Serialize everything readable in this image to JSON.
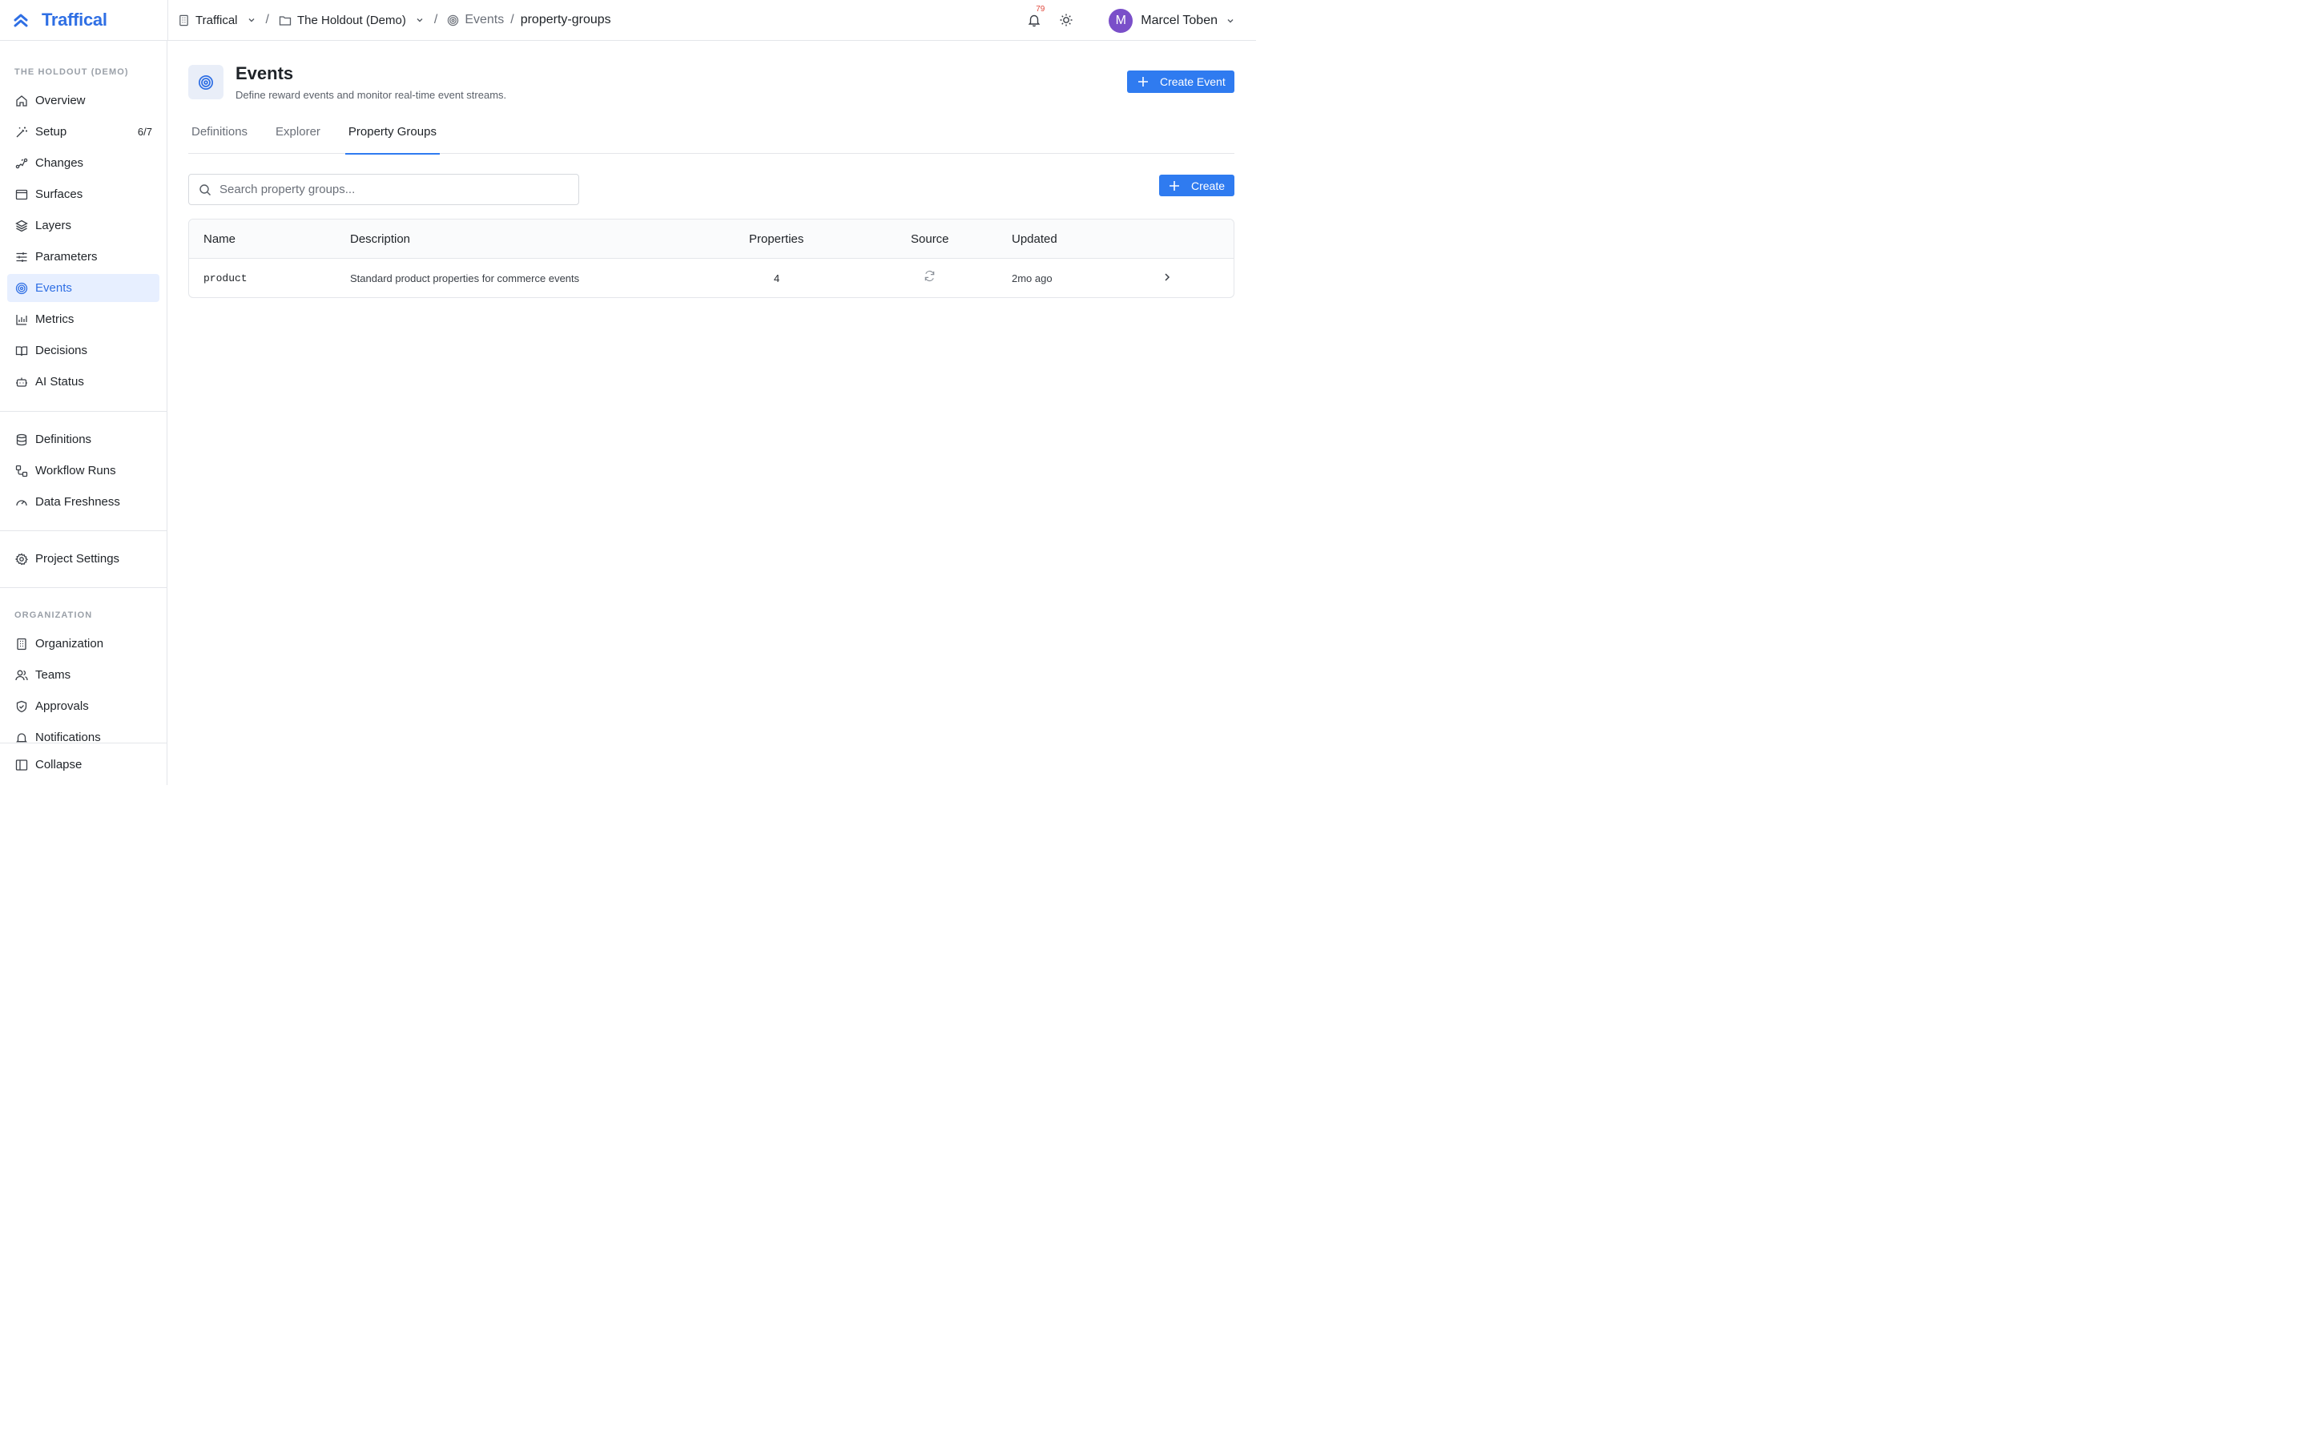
{
  "brand": {
    "name": "Traffical"
  },
  "breadcrumb": {
    "org": "Traffical",
    "project": "The Holdout (Demo)",
    "section": "Events",
    "current": "property-groups"
  },
  "header": {
    "notifications_count": "79",
    "user": {
      "initial": "M",
      "name": "Marcel Toben"
    }
  },
  "sidebar": {
    "project_label": "THE HOLDOUT (DEMO)",
    "items": [
      {
        "label": "Overview",
        "icon": "home-icon"
      },
      {
        "label": "Setup",
        "icon": "wand-icon",
        "badge": "6/7"
      },
      {
        "label": "Changes",
        "icon": "changes-icon"
      },
      {
        "label": "Surfaces",
        "icon": "window-icon"
      },
      {
        "label": "Layers",
        "icon": "layers-icon"
      },
      {
        "label": "Parameters",
        "icon": "sliders-icon"
      },
      {
        "label": "Events",
        "icon": "target-icon",
        "active": true
      },
      {
        "label": "Metrics",
        "icon": "bar-chart-icon"
      },
      {
        "label": "Decisions",
        "icon": "book-icon"
      },
      {
        "label": "AI Status",
        "icon": "bot-icon"
      }
    ],
    "secondary": [
      {
        "label": "Definitions",
        "icon": "database-icon"
      },
      {
        "label": "Workflow Runs",
        "icon": "workflow-icon"
      },
      {
        "label": "Data Freshness",
        "icon": "gauge-icon"
      }
    ],
    "settings": {
      "label": "Project Settings",
      "icon": "gear-icon"
    },
    "org_label": "ORGANIZATION",
    "org_items": [
      {
        "label": "Organization",
        "icon": "building-icon"
      },
      {
        "label": "Teams",
        "icon": "users-icon"
      },
      {
        "label": "Approvals",
        "icon": "shield-check-icon"
      },
      {
        "label": "Notifications",
        "icon": "bell-icon"
      }
    ],
    "collapse": "Collapse"
  },
  "page": {
    "title": "Events",
    "subtitle": "Define reward events and monitor real-time event streams.",
    "create_event": "Create Event",
    "tabs": [
      {
        "label": "Definitions"
      },
      {
        "label": "Explorer"
      },
      {
        "label": "Property Groups",
        "active": true
      }
    ],
    "search_placeholder": "Search property groups...",
    "create": "Create"
  },
  "table": {
    "columns": [
      "Name",
      "Description",
      "Properties",
      "Source",
      "Updated"
    ],
    "rows": [
      {
        "name": "product",
        "description": "Standard product properties for commerce events",
        "properties": "4",
        "source_icon": "sync-icon",
        "updated": "2mo ago"
      }
    ]
  },
  "colors": {
    "accent": "#2f7bf0",
    "brand": "#2f6fe4",
    "avatar": "#7a4fc9",
    "active_bg": "#e7efff"
  }
}
